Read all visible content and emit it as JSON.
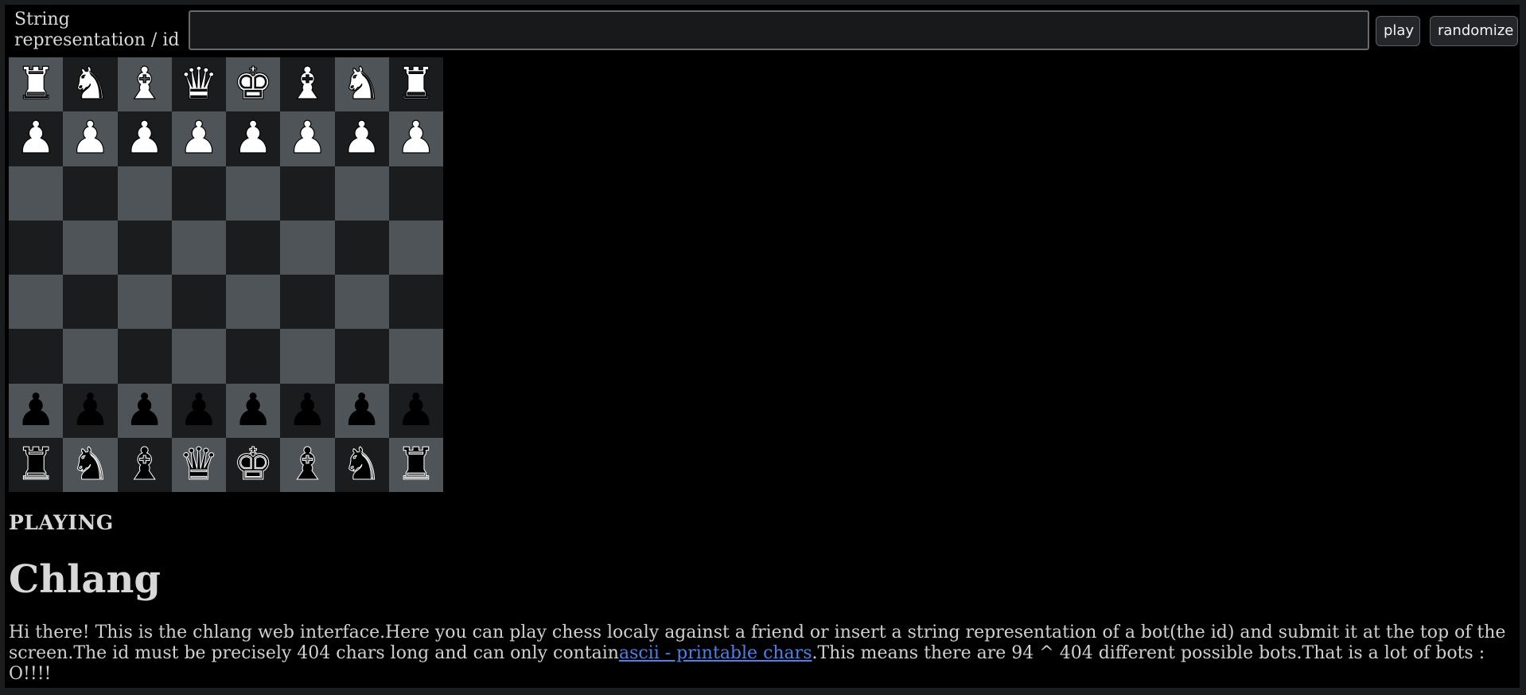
{
  "topbar": {
    "id_label": "String representation / id",
    "id_value": "",
    "play_label": "play",
    "randomize_label": "randomize"
  },
  "board": {
    "rows": [
      [
        {
          "p": "♜",
          "c": "white",
          "n": "rook"
        },
        {
          "p": "♞",
          "c": "white",
          "n": "knight"
        },
        {
          "p": "♝",
          "c": "white",
          "n": "bishop"
        },
        {
          "p": "♛",
          "c": "white",
          "n": "queen"
        },
        {
          "p": "♚",
          "c": "white",
          "n": "king"
        },
        {
          "p": "♝",
          "c": "white",
          "n": "bishop"
        },
        {
          "p": "♞",
          "c": "white",
          "n": "knight"
        },
        {
          "p": "♜",
          "c": "white",
          "n": "rook"
        }
      ],
      [
        {
          "p": "♟",
          "c": "white",
          "n": "pawn"
        },
        {
          "p": "♟",
          "c": "white",
          "n": "pawn"
        },
        {
          "p": "♟",
          "c": "white",
          "n": "pawn"
        },
        {
          "p": "♟",
          "c": "white",
          "n": "pawn"
        },
        {
          "p": "♟",
          "c": "white",
          "n": "pawn"
        },
        {
          "p": "♟",
          "c": "white",
          "n": "pawn"
        },
        {
          "p": "♟",
          "c": "white",
          "n": "pawn"
        },
        {
          "p": "♟",
          "c": "white",
          "n": "pawn"
        }
      ],
      [
        null,
        null,
        null,
        null,
        null,
        null,
        null,
        null
      ],
      [
        null,
        null,
        null,
        null,
        null,
        null,
        null,
        null
      ],
      [
        null,
        null,
        null,
        null,
        null,
        null,
        null,
        null
      ],
      [
        null,
        null,
        null,
        null,
        null,
        null,
        null,
        null
      ],
      [
        {
          "p": "♟",
          "c": "black",
          "n": "pawn"
        },
        {
          "p": "♟",
          "c": "black",
          "n": "pawn"
        },
        {
          "p": "♟",
          "c": "black",
          "n": "pawn"
        },
        {
          "p": "♟",
          "c": "black",
          "n": "pawn"
        },
        {
          "p": "♟",
          "c": "black",
          "n": "pawn"
        },
        {
          "p": "♟",
          "c": "black",
          "n": "pawn"
        },
        {
          "p": "♟",
          "c": "black",
          "n": "pawn"
        },
        {
          "p": "♟",
          "c": "black",
          "n": "pawn"
        }
      ],
      [
        {
          "p": "♜",
          "c": "black",
          "n": "rook"
        },
        {
          "p": "♞",
          "c": "black",
          "n": "knight"
        },
        {
          "p": "♝",
          "c": "black",
          "n": "bishop"
        },
        {
          "p": "♛",
          "c": "black",
          "n": "queen"
        },
        {
          "p": "♚",
          "c": "black",
          "n": "king"
        },
        {
          "p": "♝",
          "c": "black",
          "n": "bishop"
        },
        {
          "p": "♞",
          "c": "black",
          "n": "knight"
        },
        {
          "p": "♜",
          "c": "black",
          "n": "rook"
        }
      ]
    ],
    "light_color": "#4f5459",
    "dark_color": "#1b1c1e"
  },
  "status": "PLAYING",
  "title": "Chlang",
  "description": {
    "before_link": "Hi there! This is the chlang web interface.Here you can play chess localy against a friend or insert a string representation of a bot(the id) and submit it at the top of the screen.The id must be precisely 404 chars long and can only contain",
    "link_text": "ascii - printable chars",
    "after_link": ".This means there are 94 ^ 404 different possible bots.That is a lot of bots : O!!!!"
  },
  "colors": {
    "page_bg": "#000000",
    "frame": "#1b1c1e",
    "link": "#4f80e8",
    "text": "#d4d4d4"
  }
}
